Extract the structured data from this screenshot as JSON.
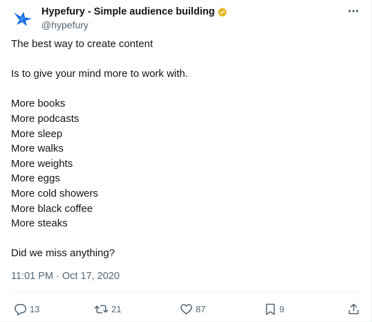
{
  "author": {
    "display_name": "Hypefury - Simple audience building",
    "handle": "@hypefury"
  },
  "tweet": {
    "lines": [
      "The best way to create content",
      "",
      "Is to give your mind more to work with.",
      "",
      "More books",
      "More podcasts",
      "More sleep",
      "More walks",
      "More weights",
      "More eggs",
      "More cold showers",
      "More black coffee",
      "More steaks",
      "",
      "Did we miss anything?"
    ],
    "timestamp": "11:01 PM · Oct 17, 2020"
  },
  "metrics": {
    "replies": "13",
    "retweets": "21",
    "likes": "87",
    "bookmarks": "9"
  },
  "icons": {
    "avatar": "hypefury-bird-logo",
    "verified": "gold-verified-badge",
    "more": "more-options-icon",
    "reply": "reply-icon",
    "retweet": "retweet-icon",
    "like": "heart-icon",
    "bookmark": "bookmark-icon",
    "share": "share-icon"
  },
  "colors": {
    "brand_blue": "#1d6fe0",
    "verified_gold": "#e2b719",
    "text_primary": "#0f1419",
    "text_secondary": "#536471"
  }
}
